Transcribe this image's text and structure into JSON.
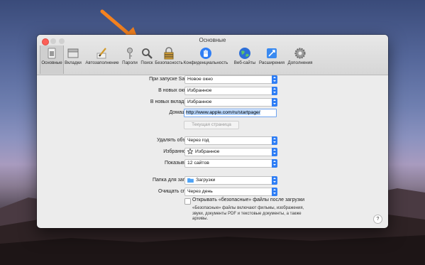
{
  "window": {
    "title": "Основные"
  },
  "toolbar": {
    "items": [
      {
        "label": "Основные",
        "icon": "general-switch-icon",
        "active": true
      },
      {
        "label": "Вкладки",
        "icon": "tabs-icon"
      },
      {
        "label": "Автозаполнение",
        "icon": "pencil-autofill-icon"
      },
      {
        "label": "Пароли",
        "icon": "key-icon"
      },
      {
        "label": "Поиск",
        "icon": "magnifier-icon"
      },
      {
        "label": "Безопасность",
        "icon": "lock-icon"
      },
      {
        "label": "Конфиденциальность",
        "icon": "privacy-hand-icon"
      },
      {
        "label": "Веб-сайты",
        "icon": "globe-icon"
      },
      {
        "label": "Расширения",
        "icon": "puzzle-icon"
      },
      {
        "label": "Дополнения",
        "icon": "gear-icon"
      }
    ]
  },
  "general": {
    "on_launch_label": "При запуске Safari открывать:",
    "on_launch_value": "Новое окно",
    "new_windows_label": "В новых окнах открывать:",
    "new_windows_value": "Избранное",
    "new_tabs_label": "В новых вкладках открывать:",
    "new_tabs_value": "Избранное",
    "homepage_label": "Домашняя страница:",
    "homepage_value": "http://www.apple.com/ru/startpage/",
    "current_page_button": "Текущая страница",
    "remove_history_label": "Удалять объекты истории:",
    "remove_history_value": "Через год",
    "favorites_shows_label": "Избранное показывает:",
    "favorites_shows_value": "Избранное",
    "top_sites_label": "Показывать топ-сайты:",
    "top_sites_value": "12 сайтов",
    "download_folder_label": "Папка для загрузки файлов:",
    "download_folder_value": "Загрузки",
    "clear_downloads_label": "Очищать список загрузок:",
    "clear_downloads_value": "Через день",
    "open_safe_label": "Открывать «безопасные» файлы после загрузки",
    "open_safe_note": "«Безопасные» файлы включают фильмы, изображения, звуки, документы PDF и текстовые документы, а также архивы.",
    "help": "?"
  },
  "colors": {
    "accent": "#2f7ef5",
    "arrow": "#f5821f",
    "close": "#fc5f57"
  }
}
